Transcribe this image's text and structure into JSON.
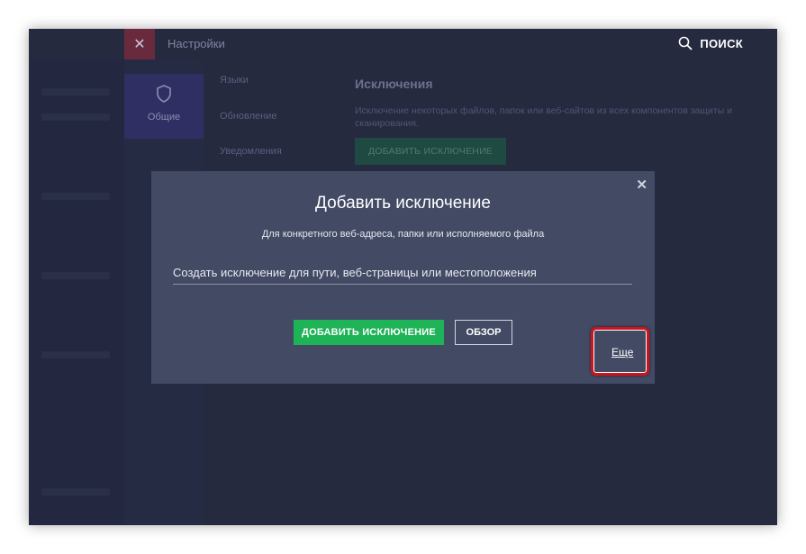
{
  "header": {
    "close_symbol": "✕",
    "title": "Настройки",
    "search_icon": "search-icon",
    "search_label": "ПОИСК"
  },
  "subnav": {
    "general_label": "Общие",
    "general_icon": "shield-icon"
  },
  "settings_menu": [
    "Языки",
    "Обновление",
    "Уведомления"
  ],
  "exclusions": {
    "heading": "Исключения",
    "description": "Исключение некоторых файлов, папок или веб-сайтов из всех компонентов защиты и сканирования.",
    "add_button_label": "ДОБАВИТЬ ИСКЛЮЧЕНИЕ"
  },
  "modal": {
    "close_symbol": "✕",
    "title": "Добавить исключение",
    "subtitle": "Для конкретного веб-адреса, папки или исполняемого файла",
    "input_placeholder": "Создать исключение для пути, веб-страницы или местоположения",
    "input_value": "",
    "add_button_label": "ДОБАВИТЬ ИСКЛЮЧЕНИЕ",
    "browse_button_label": "ОБЗОР",
    "more_link_label": "Еще"
  },
  "colors": {
    "background": "#252a3f",
    "modal_bg": "#424a64",
    "accent_green": "#1eb356",
    "highlight_red": "#d0121b",
    "white": "#ffffff"
  }
}
